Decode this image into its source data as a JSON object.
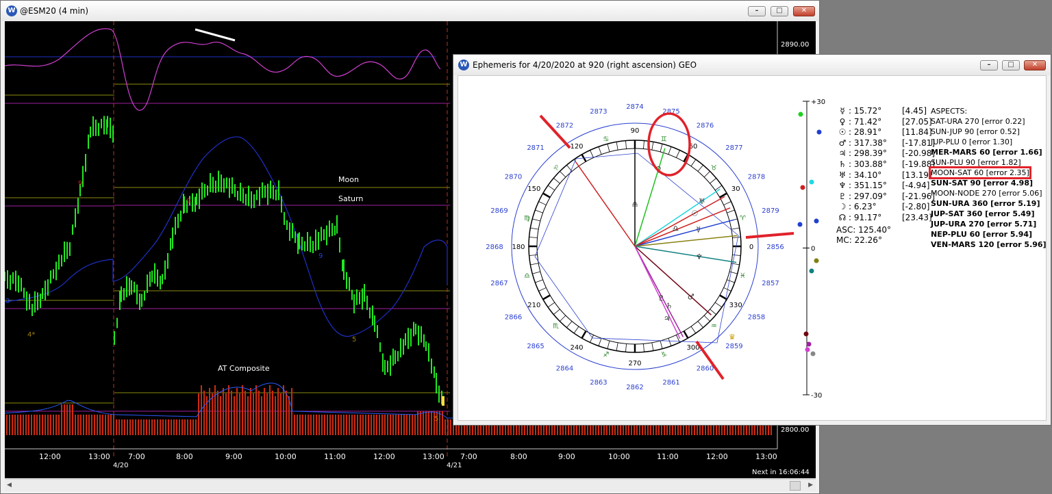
{
  "main_window": {
    "title": "@ESM20 (4 min)",
    "icon": "w-logo-icon",
    "labels": {
      "moon": "Moon",
      "saturn": "Saturn",
      "composite": "AT Composite"
    },
    "price_axis": {
      "top": "2890.00",
      "bottom": "2800.00"
    },
    "time_axis": [
      "12:00",
      "13:00",
      "7:00",
      "8:00",
      "9:00",
      "10:00",
      "11:00",
      "12:00",
      "13:00",
      "7:00",
      "8:00",
      "9:00",
      "10:00",
      "11:00",
      "12:00",
      "13:00"
    ],
    "dates": [
      "4/20",
      "4/21"
    ],
    "next_label": "Next in 16:06:44",
    "marks": {
      "nine_a": "9",
      "nine_b": "9",
      "nine_c": "9",
      "four_star": "4*",
      "five_a": "5",
      "five_b": "5"
    }
  },
  "ephemeris_window": {
    "title": "Ephemeris for 4/20/2020 at 920 (right ascension) GEO",
    "wheel_degrees": [
      "90",
      "120",
      "150",
      "180",
      "210",
      "240",
      "270",
      "300",
      "330",
      "0",
      "30",
      "60"
    ],
    "price_labels": [
      "2856",
      "2857",
      "2858",
      "2859",
      "2860",
      "2861",
      "2862",
      "2863",
      "2864",
      "2865",
      "2866",
      "2867",
      "2868",
      "2869",
      "2870",
      "2871",
      "2872",
      "2873",
      "2874",
      "2875",
      "2876",
      "2877",
      "2878",
      "2879"
    ],
    "scale": {
      "top": "+30",
      "mid": "0",
      "bottom": "-30"
    },
    "planets": [
      {
        "glyph": "☿",
        "pos": ": 15.72°",
        "lat": "[4.45]"
      },
      {
        "glyph": "♀",
        "pos": ": 71.42°",
        "lat": "[27.05]"
      },
      {
        "glyph": "☉",
        "pos": ": 28.91°",
        "lat": "[11.84]"
      },
      {
        "glyph": "♂",
        "pos": ": 317.38°",
        "lat": "[-17.81]"
      },
      {
        "glyph": "♃",
        "pos": ": 298.39°",
        "lat": "[-20.98]"
      },
      {
        "glyph": "♄",
        "pos": ": 303.88°",
        "lat": "[-19.88]"
      },
      {
        "glyph": "♅",
        "pos": ": 34.10°",
        "lat": "[13.19]"
      },
      {
        "glyph": "♆",
        "pos": ": 351.15°",
        "lat": "[-4.94]"
      },
      {
        "glyph": "♇",
        "pos": ": 297.09°",
        "lat": "[-21.96]"
      },
      {
        "glyph": "☽",
        "pos": ": 6.23°",
        "lat": "[-2.80]"
      },
      {
        "glyph": "☊",
        "pos": ": 91.17°",
        "lat": "[23.43]"
      }
    ],
    "asc": "ASC: 125.40°",
    "mc": "MC: 22.26°",
    "aspects_header": "ASPECTS:",
    "aspects": [
      {
        "text": "SAT-URA 270 [error 0.22]",
        "bold": false
      },
      {
        "text": "SUN-JUP 90 [error 0.52]",
        "bold": false
      },
      {
        "text": "JUP-PLU 0 [error 1.30]",
        "bold": false
      },
      {
        "text": "MER-MARS 60 [error 1.66]",
        "bold": true
      },
      {
        "text": "SUN-PLU 90 [error 1.82]",
        "bold": false
      },
      {
        "text": "MOON-SAT 60 [error 2.35]",
        "bold": false,
        "highlight": true
      },
      {
        "text": "SUN-SAT 90 [error 4.98]",
        "bold": true
      },
      {
        "text": "MOON-NODE 270 [error 5.06]",
        "bold": false
      },
      {
        "text": "SUN-URA 360 [error 5.19]",
        "bold": true
      },
      {
        "text": "JUP-SAT 360 [error 5.49]",
        "bold": true
      },
      {
        "text": "JUP-URA 270 [error 5.71]",
        "bold": true
      },
      {
        "text": "NEP-PLU 60 [error 5.94]",
        "bold": true
      },
      {
        "text": "VEN-MARS 120 [error 5.96]",
        "bold": true
      }
    ]
  },
  "colors": {
    "price_bar": "#22e822",
    "oscillator": "#d040d0",
    "band": "#2030c8",
    "histogram": "#d02a10",
    "annotation": "#e0222a",
    "hline_yellow": "#8c8c10",
    "hline_magenta": "#a020a0"
  }
}
